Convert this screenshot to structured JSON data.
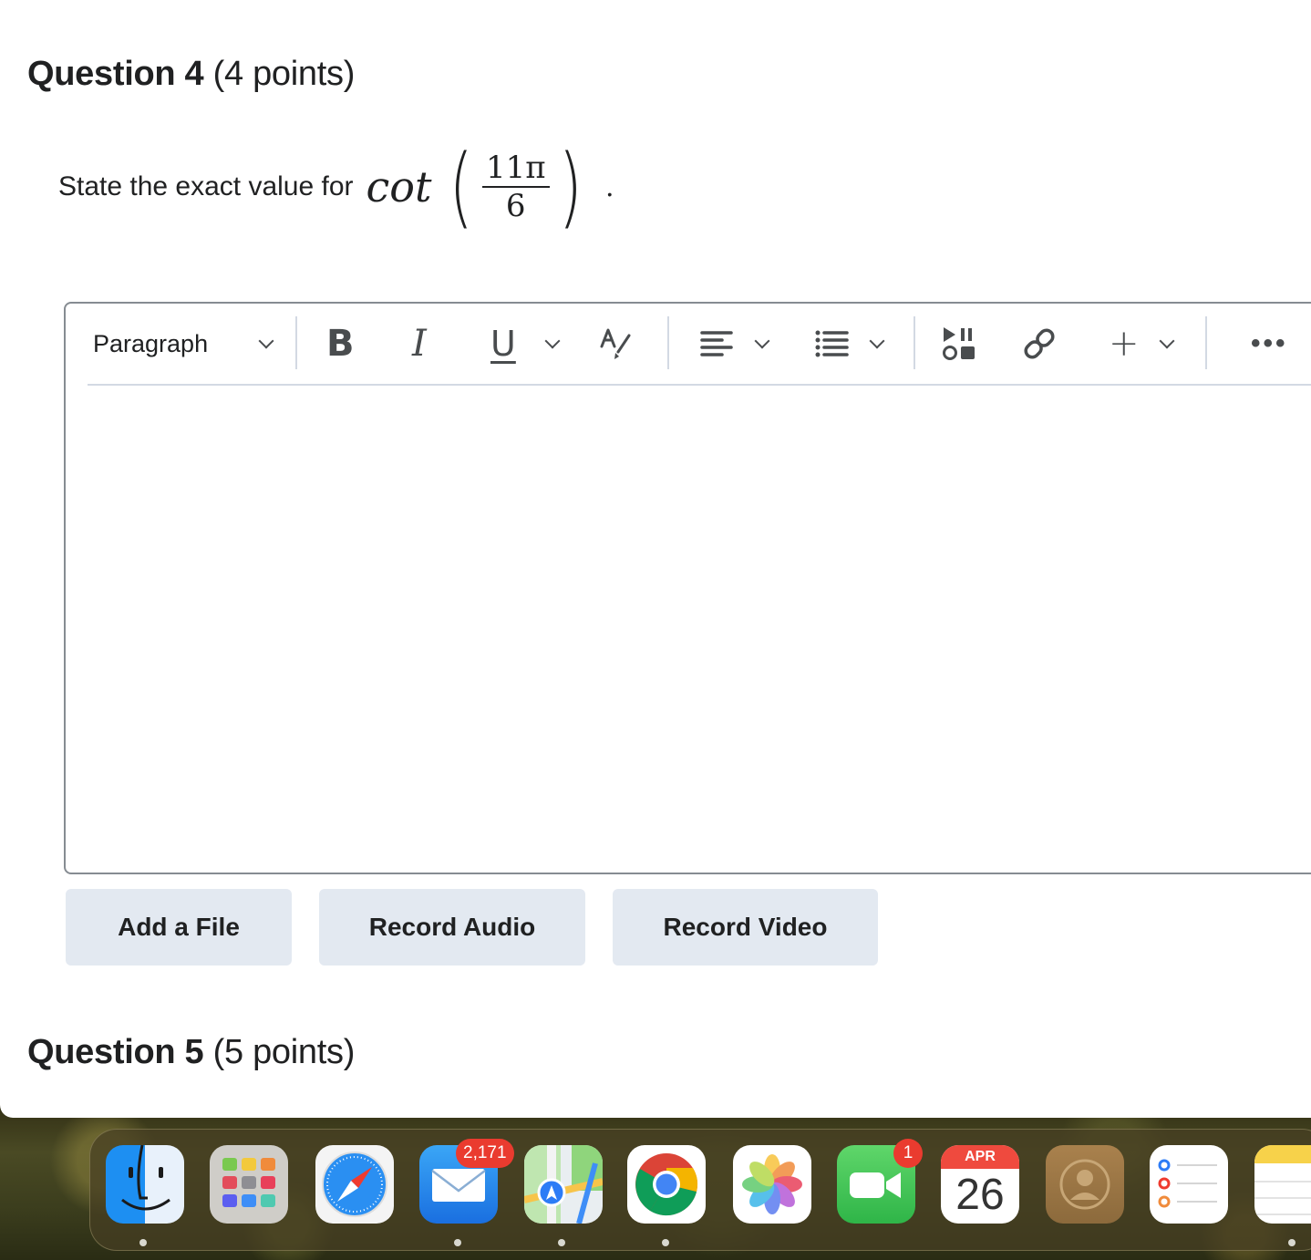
{
  "questions": {
    "q4": {
      "label": "Question 4",
      "points": "(4 points)"
    },
    "q5": {
      "label": "Question 5",
      "points": "(5 points)"
    }
  },
  "prompt": {
    "text": "State the exact value for",
    "func": "cot",
    "numerator": "11π",
    "denominator": "6",
    "period": "."
  },
  "toolbar": {
    "paragraph": "Paragraph",
    "bold": "B",
    "italic": "I",
    "underline": "U",
    "insert": "+",
    "more": "•••"
  },
  "actions": {
    "add_file": "Add a File",
    "record_audio": "Record Audio",
    "record_video": "Record Video"
  },
  "dock": {
    "apps": [
      "finder-icon",
      "launchpad-icon",
      "safari-icon",
      "mail-icon",
      "maps-icon",
      "chrome-icon",
      "photos-icon",
      "facetime-icon",
      "calendar-icon",
      "contacts-icon",
      "reminders-icon",
      "notes-icon"
    ],
    "mail_badge": "2,171",
    "facetime_badge": "1",
    "calendar_month": "APR",
    "calendar_day": "26"
  }
}
